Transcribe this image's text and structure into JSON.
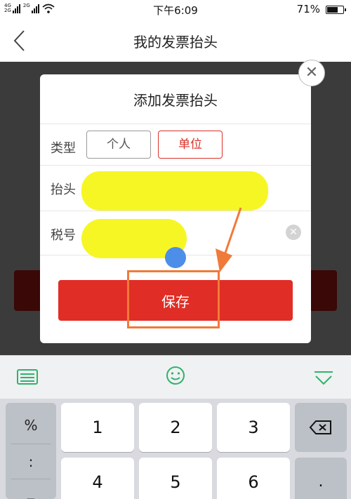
{
  "status_bar": {
    "network_top": "4G",
    "network_bottom": "2G",
    "network2_top": "2G",
    "time": "下午6:09",
    "battery": "71%",
    "battery_level": 0.71
  },
  "nav": {
    "title": "我的发票抬头"
  },
  "dialog": {
    "title": "添加发票抬头",
    "type_label": "类型",
    "type_options": [
      "个人",
      "单位"
    ],
    "selected_type": "单位",
    "header_label": "抬头",
    "tax_label": "税号",
    "save_label": "保存",
    "close_symbol": "✕",
    "clear_symbol": "✕"
  },
  "colors": {
    "accent_red": "#e02d25",
    "annotation_orange": "#f07a3a",
    "redaction_yellow": "#f6f625",
    "keyboard_green": "#2fb36b"
  },
  "keyboard": {
    "symbols": [
      "%",
      ":",
      "_"
    ],
    "keys_row1": [
      "1",
      "2",
      "3"
    ],
    "keys_row2": [
      "4",
      "5",
      "6"
    ],
    "row2_side": "."
  }
}
